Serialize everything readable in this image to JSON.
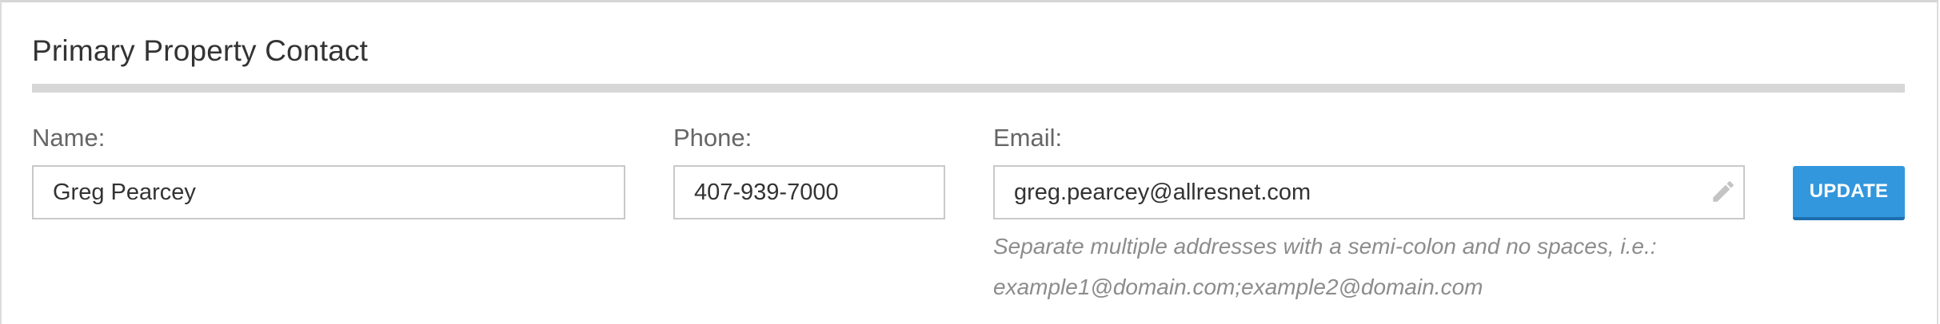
{
  "section": {
    "title": "Primary Property Contact"
  },
  "fields": {
    "name": {
      "label": "Name:",
      "value": "Greg Pearcey"
    },
    "phone": {
      "label": "Phone:",
      "value": "407-939-7000"
    },
    "email": {
      "label": "Email:",
      "value": "greg.pearcey@allresnet.com"
    }
  },
  "email_help": {
    "line1": "Separate multiple addresses with a semi-colon and no spaces, i.e.:",
    "line2": "example1@domain.com;example2@domain.com"
  },
  "actions": {
    "update_label": "UPDATE"
  },
  "colors": {
    "accent": "#3397dd",
    "rule": "#d7d7d7",
    "helper_text": "#8c8c8c"
  },
  "icons": {
    "email_edit": "pencil-icon"
  }
}
